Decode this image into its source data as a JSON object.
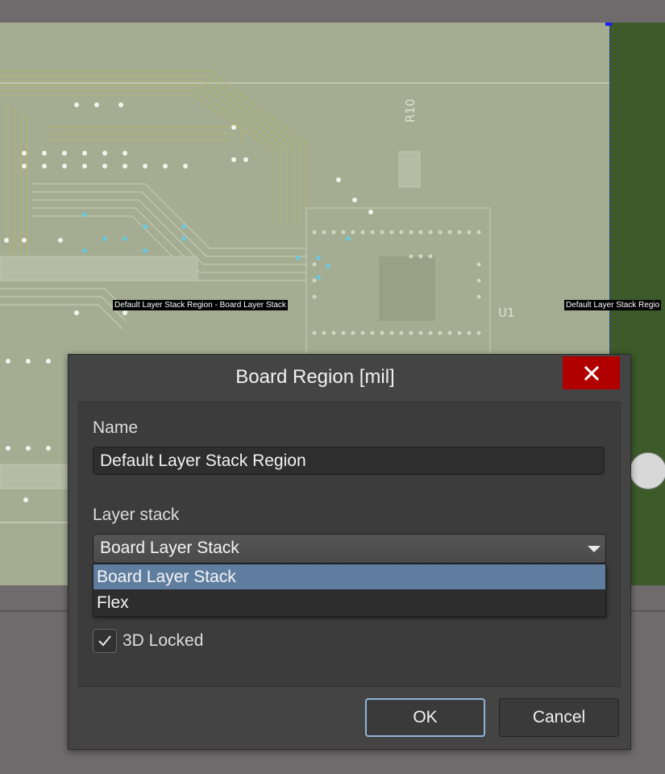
{
  "canvas": {
    "region_label_left": "Default Layer Stack Region - Board Layer Stack",
    "region_label_right": "Default Layer Stack Regio",
    "designator_r10": "R10",
    "designator_u1": "U1"
  },
  "dialog": {
    "title": "Board Region [mil]",
    "close_symbol": "✕",
    "name_label": "Name",
    "name_value": "Default Layer Stack Region",
    "layer_stack_label": "Layer stack",
    "layer_stack_selected": "Board Layer Stack",
    "layer_stack_options": [
      "Board Layer Stack",
      "Flex"
    ],
    "locked_label": "3D Locked",
    "locked_checked": true,
    "ok_label": "OK",
    "cancel_label": "Cancel"
  },
  "colors": {
    "canvas_bg": "#a4ac91",
    "region_green": "#3c5a2a",
    "dialog_bg": "#444444",
    "close_red": "#b00000",
    "selected_option": "#5f7e9f",
    "ok_border": "#8fb4d9"
  }
}
